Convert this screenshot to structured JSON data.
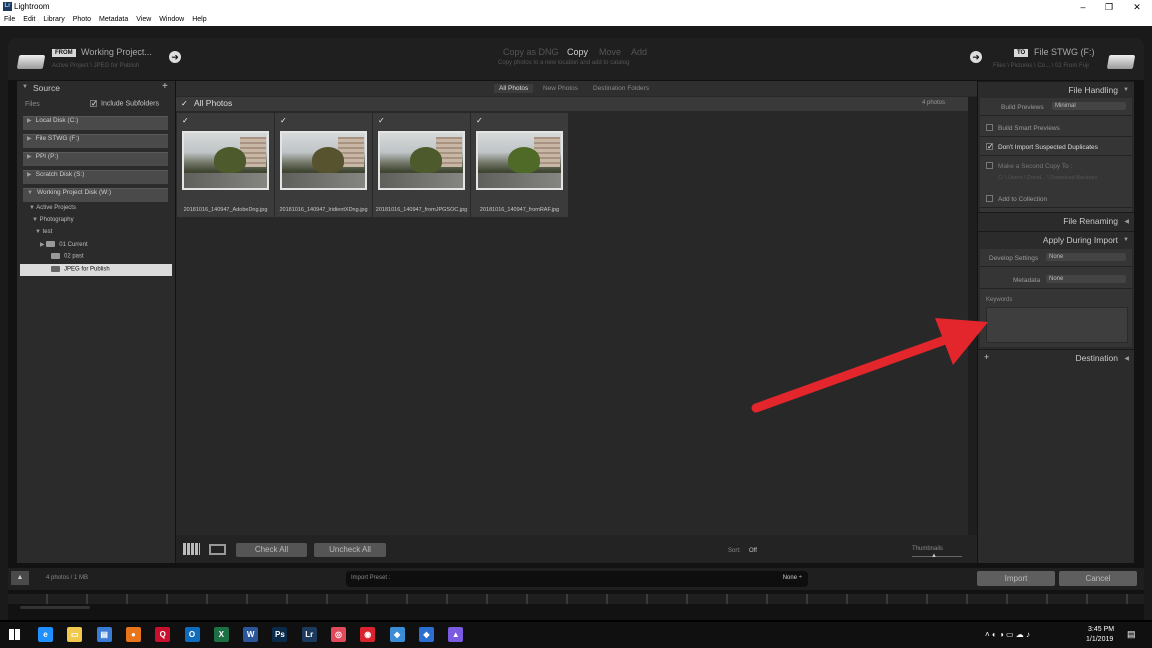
{
  "window": {
    "title": "Lightroom",
    "app_badge": "Lr",
    "controls": [
      "‒",
      "❐",
      "✕"
    ]
  },
  "menu": [
    "File",
    "Edit",
    "Library",
    "Photo",
    "Metadata",
    "View",
    "Window",
    "Help"
  ],
  "header": {
    "from_badge": "FROM",
    "from_source": "Working Project...",
    "from_path": "Active Project \\ JPEG for Publish",
    "modes": [
      "Copy as DNG",
      "Copy",
      "Move",
      "Add"
    ],
    "active_mode": "Copy",
    "mode_description": "Copy photos to a new location and add to catalog",
    "to_badge": "TO",
    "to_dest": "File STWG (F:)",
    "to_path": "Files \\ Pictures \\ Co... \\ 02 From Fuji"
  },
  "source": {
    "title": "Source",
    "files_label": "Files",
    "include_subfolders": "Include Subfolders",
    "volumes": [
      "Local Disk (C:)",
      "File STWG (F:)",
      "PPI (P:)",
      "Scratch Disk (S:)",
      "Working Project Disk (W:)"
    ],
    "tree": [
      "Active Projects",
      "Photography",
      "test",
      "01 Current",
      "02 past",
      "JPEG for Publish"
    ]
  },
  "grid": {
    "tabs": [
      "All Photos",
      "New Photos",
      "Destination Folders"
    ],
    "section_title": "All Photos",
    "count": "4 photos",
    "photos": [
      "20181016_140947_AdobeDng.jpg",
      "20181016_140947_IridientXDng.jpg",
      "20181016_140947_fromJPGSOC.jpg",
      "20181016_140947_fromRAF.jpg"
    ],
    "check_all": "Check All",
    "uncheck_all": "Uncheck All",
    "sort_label": "Sort:",
    "sort_value": "Off",
    "thumbnails_label": "Thumbnails"
  },
  "right": {
    "file_handling": "File Handling",
    "build_previews_label": "Build Previews",
    "build_previews_value": "Minimal",
    "build_smart": "Build Smart Previews",
    "dont_import": "Don't Import Suspected Duplicates",
    "second_copy": "Make a Second Copy To :",
    "second_copy_path": "C: \\ Users \\ David... \\ Download Backups",
    "add_collection": "Add to Collection",
    "file_renaming": "File Renaming",
    "apply_during": "Apply During Import",
    "develop_label": "Develop Settings",
    "develop_value": "None",
    "metadata_label": "Metadata",
    "metadata_value": "None",
    "keywords_label": "Keywords",
    "destination": "Destination"
  },
  "bottom": {
    "info": "4 photos / 1 MB",
    "preset_label": "Import Preset :",
    "preset_value": "None ÷",
    "import": "Import",
    "cancel": "Cancel"
  },
  "taskbar": {
    "time": "3:45 PM",
    "date": "1/1/2019",
    "apps": [
      {
        "label": "e",
        "color": "#1e90ff",
        "name": "edge-icon"
      },
      {
        "label": "▭",
        "color": "#f2c94c",
        "name": "file-explorer-icon"
      },
      {
        "label": "▤",
        "color": "#3a7bd5",
        "name": "store-icon"
      },
      {
        "label": "●",
        "color": "#e8741c",
        "name": "firefox-icon"
      },
      {
        "label": "Q",
        "color": "#c8102e",
        "name": "quicken-icon"
      },
      {
        "label": "O",
        "color": "#0f6cbd",
        "name": "outlook-icon"
      },
      {
        "label": "X",
        "color": "#1d7044",
        "name": "excel-icon"
      },
      {
        "label": "W",
        "color": "#2b579a",
        "name": "word-icon"
      },
      {
        "label": "Ps",
        "color": "#0a2a4a",
        "name": "photoshop-icon"
      },
      {
        "label": "Lr",
        "color": "#1c3a5e",
        "name": "lightroom-icon"
      },
      {
        "label": "◎",
        "color": "#e04a5a",
        "name": "app-icon-1"
      },
      {
        "label": "◉",
        "color": "#d9232e",
        "name": "app-icon-2"
      },
      {
        "label": "◆",
        "color": "#3c8dd8",
        "name": "app-icon-3"
      },
      {
        "label": "◆",
        "color": "#2a6fd1",
        "name": "app-icon-4"
      },
      {
        "label": "▲",
        "color": "#7b5ce0",
        "name": "affinity-icon"
      }
    ]
  }
}
